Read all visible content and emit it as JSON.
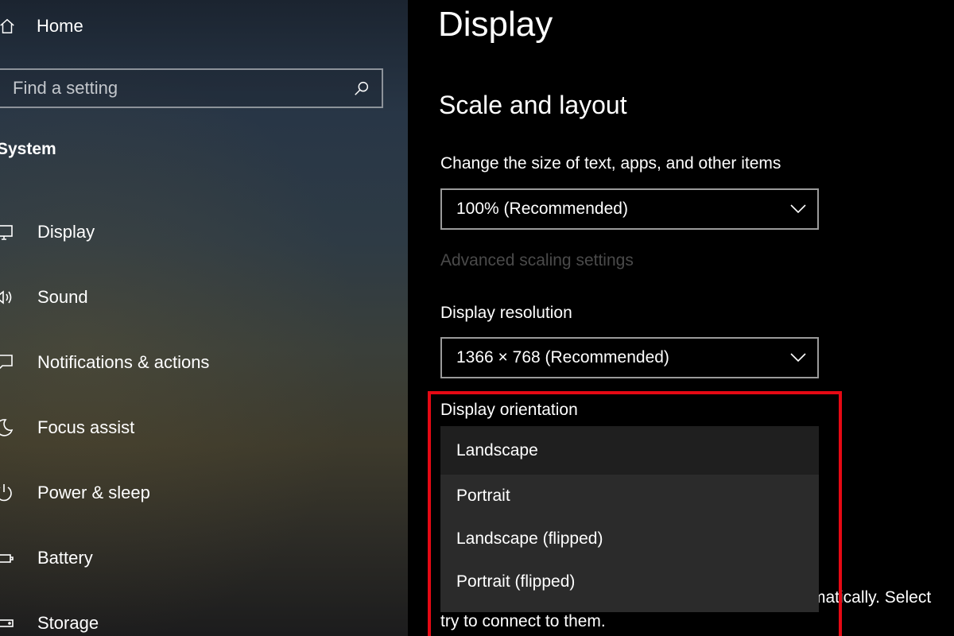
{
  "sidebar": {
    "home_label": "Home",
    "search_placeholder": "Find a setting",
    "section_label": "System",
    "items": [
      {
        "label": "Display",
        "icon": "monitor-icon"
      },
      {
        "label": "Sound",
        "icon": "speaker-icon"
      },
      {
        "label": "Notifications & actions",
        "icon": "message-icon"
      },
      {
        "label": "Focus assist",
        "icon": "moon-icon"
      },
      {
        "label": "Power & sleep",
        "icon": "power-icon"
      },
      {
        "label": "Battery",
        "icon": "battery-icon"
      },
      {
        "label": "Storage",
        "icon": "storage-icon"
      }
    ]
  },
  "main": {
    "title": "Display",
    "section_title": "Scale and layout",
    "scale_label": "Change the size of text, apps, and other items",
    "scale_value": "100% (Recommended)",
    "advanced_link": "Advanced scaling settings",
    "resolution_label": "Display resolution",
    "resolution_value": "1366 × 768 (Recommended)",
    "orientation_label": "Display orientation",
    "orientation_options": [
      "Landscape",
      "Portrait",
      "Landscape (flipped)",
      "Portrait (flipped)"
    ],
    "obscured_text_right": "matically. Select",
    "obscured_text_bottom": "try to connect to them."
  },
  "colors": {
    "highlight": "#e50914",
    "dropdown_menu": "#2b2b2b",
    "disabled_link": "#4a4a4a"
  }
}
